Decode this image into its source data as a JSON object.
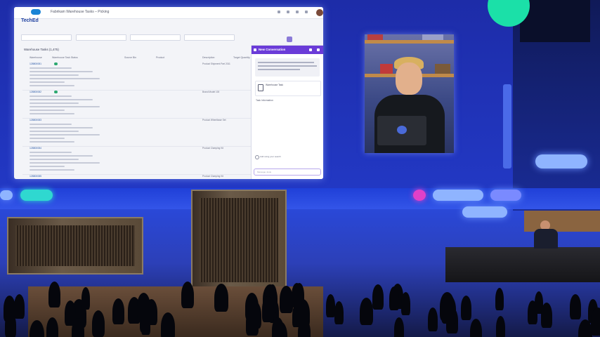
{
  "colors": {
    "brand_blue": "#1d3fa0",
    "chat_header": "#6a3bd8",
    "status_green": "#2ca870",
    "stage_accent": "#1be0a8",
    "stage_pink": "#e040c8"
  },
  "screen": {
    "tab_title": "Fabrikam Warehouse Tasks – Picking",
    "brand": "TechEd",
    "section_title": "Warehouse Tasks (1,475)",
    "columns": [
      "Warehouse",
      "Warehouse Task Status",
      "Source Bin",
      "Product",
      "Description",
      "Target Quantity"
    ],
    "rows": [
      {
        "id": "128800081",
        "status": "",
        "source_bin": "",
        "product": "",
        "description": "Product Shipment Part 2011"
      },
      {
        "id": "128800082",
        "status": "",
        "source_bin": "",
        "product": "",
        "description": "Brand Model 100"
      },
      {
        "id": "128800083",
        "status": "",
        "source_bin": "",
        "product": "",
        "description": "Product Wheelbase Set"
      },
      {
        "id": "128800084",
        "status": "",
        "source_bin": "",
        "product": "",
        "description": "Product Clamping Kit"
      },
      {
        "id": "128800085",
        "status": "",
        "source_bin": "",
        "product": "",
        "description": "Product Clamping Kit"
      }
    ]
  },
  "chat": {
    "title": "New Conversation",
    "card_title": "Warehouse Task",
    "info_heading": "Task Information",
    "checkbox_label": "Add using your search",
    "input_placeholder": "Message Joule"
  },
  "icons": [
    "logo-icon",
    "search-icon",
    "bell-icon",
    "settings-icon",
    "chat-icon",
    "expand-icon",
    "close-icon",
    "checkmark-icon",
    "task-icon"
  ]
}
